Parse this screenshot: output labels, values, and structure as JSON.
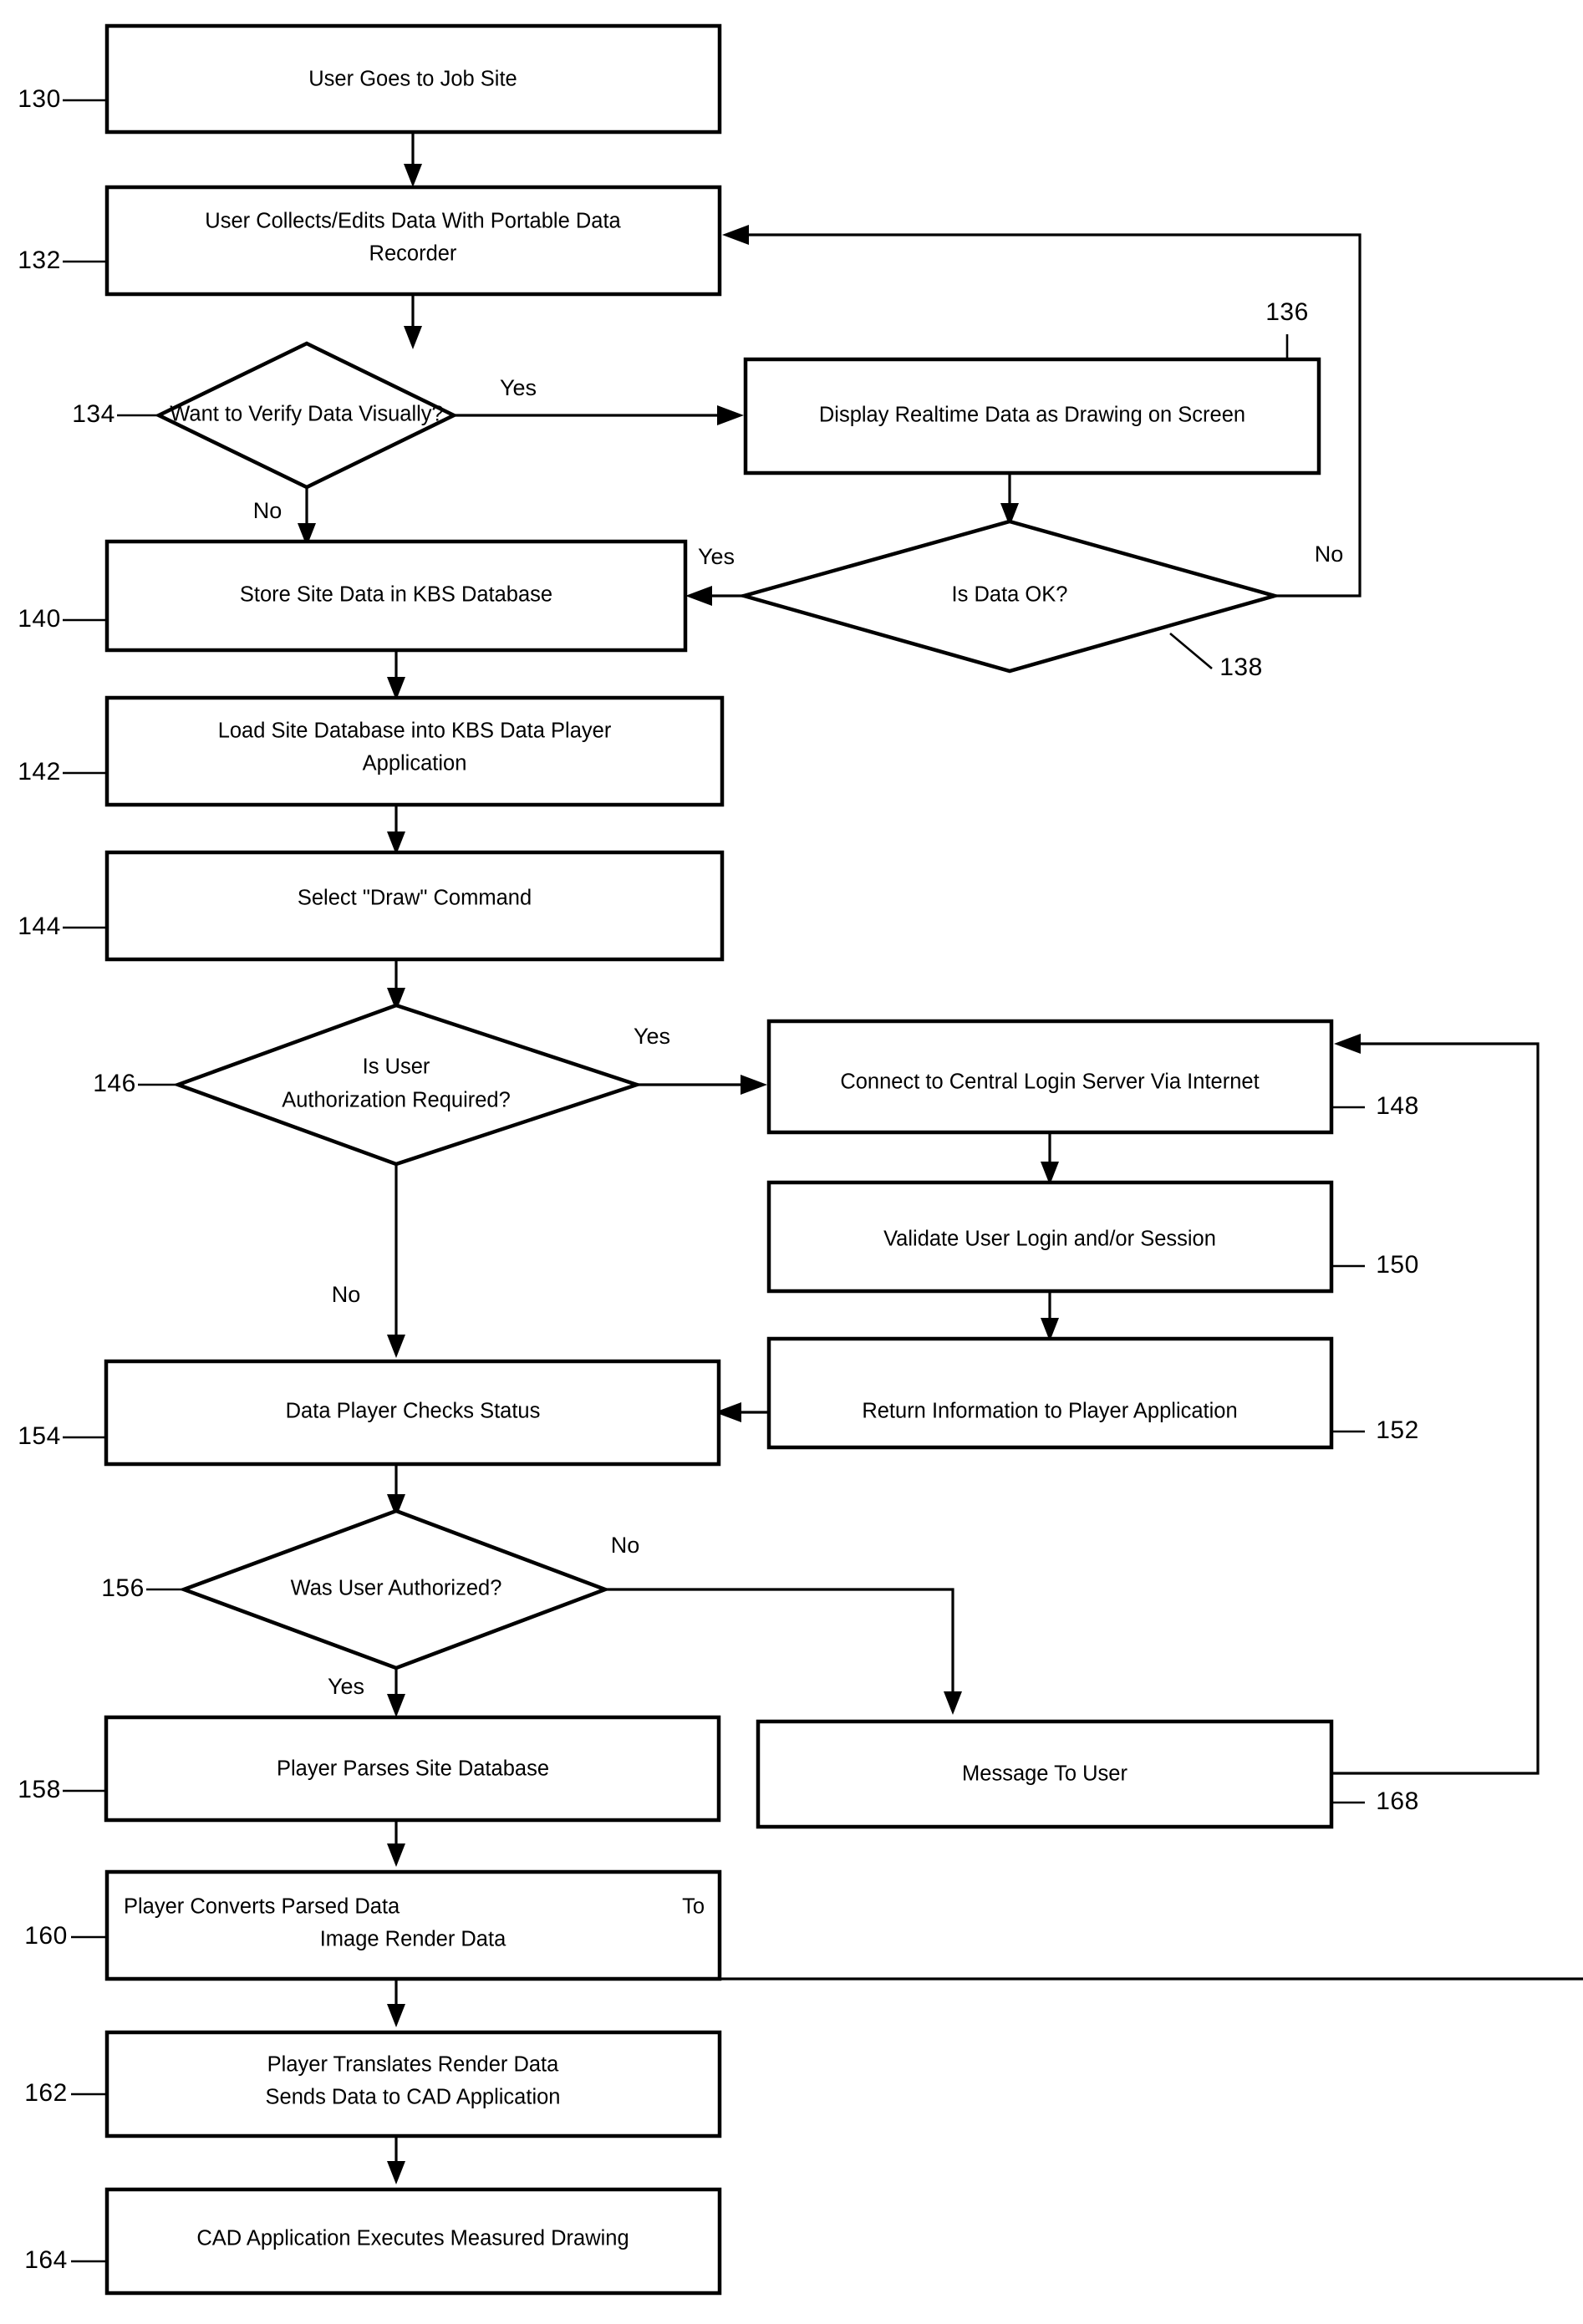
{
  "figure": {
    "type": "flowchart",
    "orientation": "top-to-bottom",
    "background_color": "#ffffff",
    "line_color": "#000000"
  },
  "nodes": {
    "n130": {
      "ref": "130",
      "shape": "process",
      "text": "User Goes to Job Site"
    },
    "n132": {
      "ref": "132",
      "shape": "process",
      "line1": "User Collects/Edits Data With Portable Data",
      "line2": "Recorder"
    },
    "n134": {
      "ref": "134",
      "shape": "decision",
      "text": "Want to Verify Data Visually?"
    },
    "n136": {
      "ref": "136",
      "shape": "process",
      "text": "Display Realtime Data as Drawing on Screen"
    },
    "n138": {
      "ref": "138",
      "shape": "decision",
      "text": "Is Data OK?"
    },
    "n140": {
      "ref": "140",
      "shape": "process",
      "text": "Store Site Data in KBS Database"
    },
    "n142": {
      "ref": "142",
      "shape": "process",
      "line1": "Load Site Database into KBS Data Player",
      "line2": "Application"
    },
    "n144": {
      "ref": "144",
      "shape": "process",
      "text": "Select \"Draw\" Command"
    },
    "n146": {
      "ref": "146",
      "shape": "decision",
      "line1": "Is User",
      "line2": "Authorization Required?"
    },
    "n148": {
      "ref": "148",
      "shape": "process",
      "text": "Connect to Central Login Server Via Internet"
    },
    "n150": {
      "ref": "150",
      "shape": "process",
      "text": "Validate User Login and/or Session"
    },
    "n152": {
      "ref": "152",
      "shape": "process",
      "text": "Return Information to Player Application"
    },
    "n154": {
      "ref": "154",
      "shape": "process",
      "text": "Data Player Checks Status"
    },
    "n156": {
      "ref": "156",
      "shape": "decision",
      "text": "Was User Authorized?"
    },
    "n158": {
      "ref": "158",
      "shape": "process",
      "text": "Player Parses Site Database"
    },
    "n160": {
      "ref": "160",
      "shape": "process",
      "line1": "Player Converts Parsed Data",
      "line1_right": "To",
      "line2": "Image Render Data"
    },
    "n162": {
      "ref": "162",
      "shape": "process",
      "line1": "Player Translates Render Data",
      "line2": "Sends Data to CAD Application"
    },
    "n164": {
      "ref": "164",
      "shape": "process",
      "text": "CAD Application Executes Measured Drawing"
    },
    "n168": {
      "ref": "168",
      "shape": "process",
      "text": "Message To User"
    }
  },
  "branch_labels": {
    "b134_yes": "Yes",
    "b134_no": "No",
    "b138_yes": "Yes",
    "b138_no": "No",
    "b146_yes": "Yes",
    "b146_no": "No",
    "b156_yes": "Yes",
    "b156_no": "No"
  }
}
